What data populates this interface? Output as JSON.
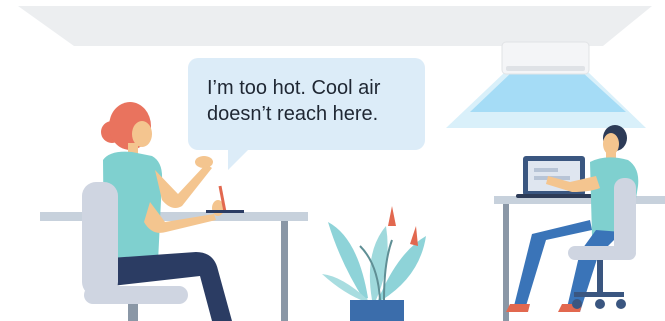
{
  "speech_bubble": {
    "line1": "I’m too hot. Cool air",
    "line2": "doesn’t reach here."
  },
  "colors": {
    "ceiling": "#eceef0",
    "bubble": "#dcecf8",
    "airflow": "#8fd3f3",
    "desk": "#c7d1dc",
    "desk_legs": "#8a97a6",
    "chair": "#cfd5e1",
    "woman_hair": "#e9735e",
    "woman_top": "#7fd0cf",
    "skin": "#f4c58f",
    "trousers": "#2b3c63",
    "man_hair": "#2d3b57",
    "man_trousers": "#3a74b8",
    "laptop": "#3a5680",
    "plant_leaves": "#8ed3d8",
    "plant_pot": "#3b6dab",
    "plant_flower": "#e2684f"
  }
}
